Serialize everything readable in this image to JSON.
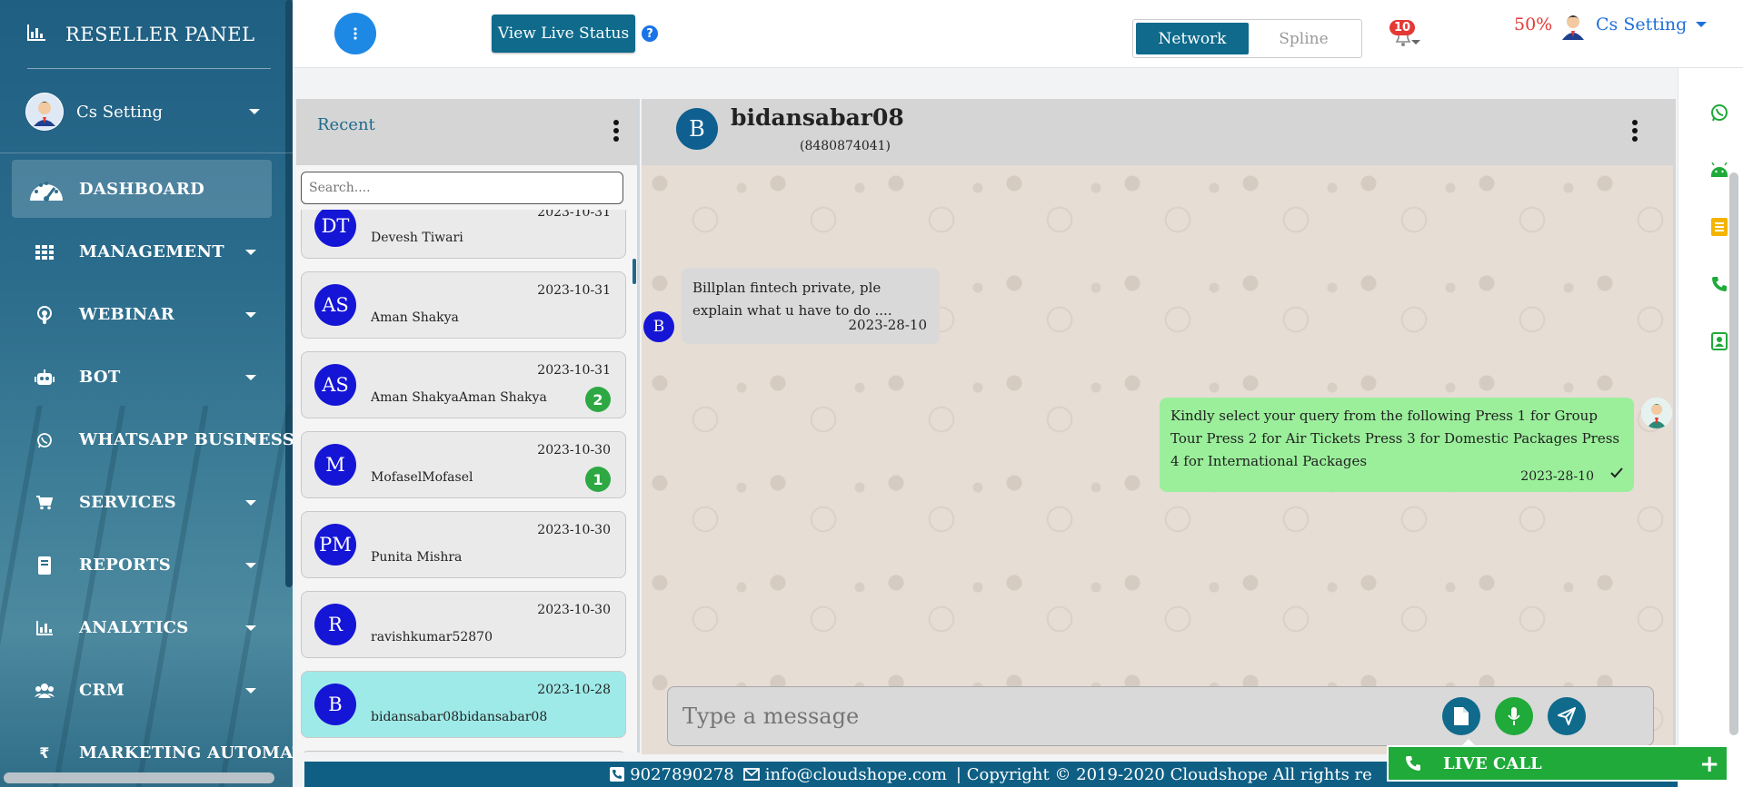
{
  "sidebar": {
    "brand": "RESELLER PANEL",
    "user": "Cs Setting",
    "items": [
      {
        "label": "DASHBOARD",
        "icon": "speedometer-icon",
        "active": true
      },
      {
        "label": "MANAGEMENT",
        "icon": "grid-icon"
      },
      {
        "label": "WEBINAR",
        "icon": "podcast-icon"
      },
      {
        "label": "BOT",
        "icon": "robot-icon"
      },
      {
        "label": "WHATSAPP BUSINESS",
        "icon": "whatsapp-icon"
      },
      {
        "label": "SERVICES",
        "icon": "cart-icon"
      },
      {
        "label": "REPORTS",
        "icon": "book-icon"
      },
      {
        "label": "ANALYTICS",
        "icon": "bar-chart-icon"
      },
      {
        "label": "CRM",
        "icon": "users-icon"
      },
      {
        "label": "MARKETING AUTOMATION",
        "icon": "rupee-icon"
      }
    ]
  },
  "topbar": {
    "live_status": "View Live Status",
    "toggle": {
      "on": "Network",
      "off": "Spline"
    },
    "notifications": "10",
    "percent": "50%",
    "user": "Cs Setting"
  },
  "contacts": {
    "title": "Recent",
    "search_placeholder": "Search....",
    "items": [
      {
        "initials": "DT",
        "name": "Devesh Tiwari",
        "date": "2023-10-31",
        "count": ""
      },
      {
        "initials": "AS",
        "name": "Aman Shakya",
        "date": "2023-10-31",
        "count": ""
      },
      {
        "initials": "AS",
        "name": "Aman ShakyaAman Shakya",
        "date": "2023-10-31",
        "count": "2"
      },
      {
        "initials": "M",
        "name": "MofaselMofasel",
        "date": "2023-10-30",
        "count": "1"
      },
      {
        "initials": "PM",
        "name": "Punita Mishra",
        "date": "2023-10-30",
        "count": ""
      },
      {
        "initials": "R",
        "name": "ravishkumar52870",
        "date": "2023-10-30",
        "count": ""
      },
      {
        "initials": "B",
        "name": "bidansabar08bidansabar08",
        "date": "2023-10-28",
        "count": "",
        "active": true
      }
    ]
  },
  "chat": {
    "initial": "B",
    "name": "bidansabar08",
    "phone": "(8480874041)",
    "incoming": {
      "initial": "B",
      "text": "Billplan fintech private, ple explain what u have to do ....",
      "time": "2023-28-10"
    },
    "outgoing": {
      "text": "Kindly select your query from the following Press 1 for Group Tour Press 2 for Air Tickets Press 3 for Domestic Packages Press 4 for International Packages",
      "time": "2023-28-10"
    },
    "composer_placeholder": "Type a message"
  },
  "footer": {
    "phone": "9027890278",
    "email": "info@cloudshope.com",
    "copyright": "| Copyright © 2019-2020 Cloudshope All rights re"
  },
  "live_call": "LIVE CALL",
  "colors": {
    "primary": "#0f6a8c",
    "accent_green": "#1faa3a",
    "badge_red": "#e53935",
    "avatar_blue": "#1515d6"
  }
}
